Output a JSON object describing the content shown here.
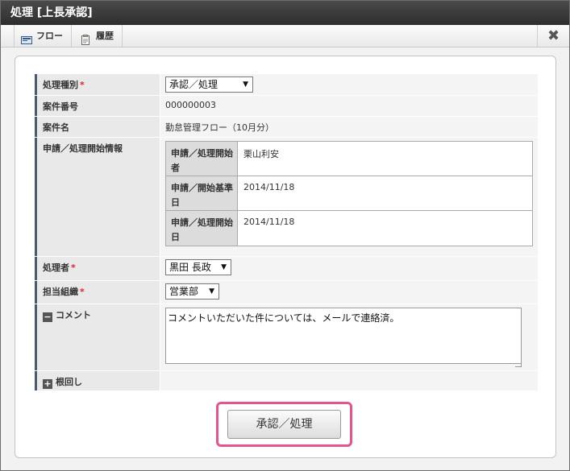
{
  "window": {
    "title": "処理 [上長承認]"
  },
  "toolbar": {
    "flow_label": "フロー",
    "history_label": "履歴",
    "close_glyph": "✖"
  },
  "form": {
    "process_type": {
      "label": "処理種別",
      "required_mark": "*",
      "value": "承認／処理"
    },
    "case_number": {
      "label": "案件番号",
      "value": "000000003"
    },
    "case_name": {
      "label": "案件名",
      "value": "勤怠管理フロー（10月分）"
    },
    "start_info": {
      "label": "申請／処理開始情報",
      "rows": [
        {
          "label": "申請／処理開始者",
          "value": "栗山利安"
        },
        {
          "label": "申請／開始基準日",
          "value": "2014/11/18"
        },
        {
          "label": "申請／処理開始日",
          "value": "2014/11/18"
        }
      ]
    },
    "processor": {
      "label": "処理者",
      "required_mark": "*",
      "value": "黒田 長政"
    },
    "org": {
      "label": "担当組織",
      "required_mark": "*",
      "value": "営業部"
    },
    "comment": {
      "label": "コメント",
      "toggle": "−",
      "value": "コメントいただいた件については、メールで連絡済。"
    },
    "nemawashi": {
      "label": "根回し",
      "toggle": "+"
    }
  },
  "actions": {
    "submit_label": "承認／処理"
  },
  "colors": {
    "title_bg": "#3a3a3a",
    "label_border": "#4b5a73",
    "highlight": "#e6548e"
  }
}
